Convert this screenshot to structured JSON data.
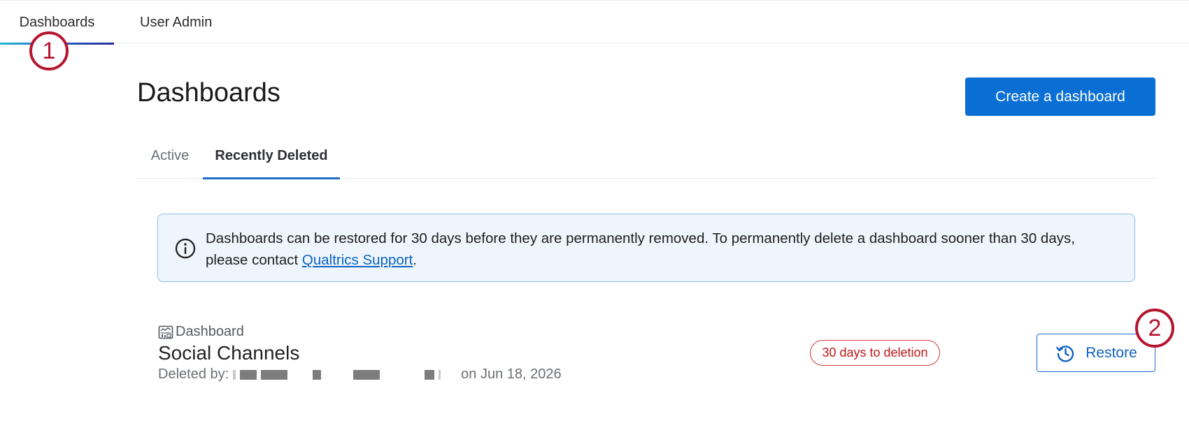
{
  "top_nav": {
    "tabs": [
      {
        "label": "Dashboards"
      },
      {
        "label": "User Admin"
      }
    ]
  },
  "callouts": {
    "first": "1",
    "second": "2"
  },
  "header": {
    "title": "Dashboards",
    "create_button": "Create a dashboard"
  },
  "tabs": [
    {
      "label": "Active"
    },
    {
      "label": "Recently Deleted"
    }
  ],
  "banner": {
    "icon": "info-icon",
    "text_before": "Dashboards can be restored for 30 days before they are permanently removed. To permanently delete a dashboard sooner than 30 days, please contact ",
    "link_text": "Qualtrics Support",
    "text_after": "."
  },
  "item": {
    "type_icon": "dashboard-icon",
    "type_label": "Dashboard",
    "title": "Social Channels",
    "deleted_by_label": "Deleted by:",
    "deleted_date": "on Jun 18, 2026",
    "badge": "30 days to deletion",
    "restore_icon": "history-icon",
    "restore_label": "Restore"
  },
  "colors": {
    "primary": "#0a6fd4",
    "callout": "#b5162f",
    "badge": "#c01818",
    "banner_bg": "#eef5fd"
  }
}
